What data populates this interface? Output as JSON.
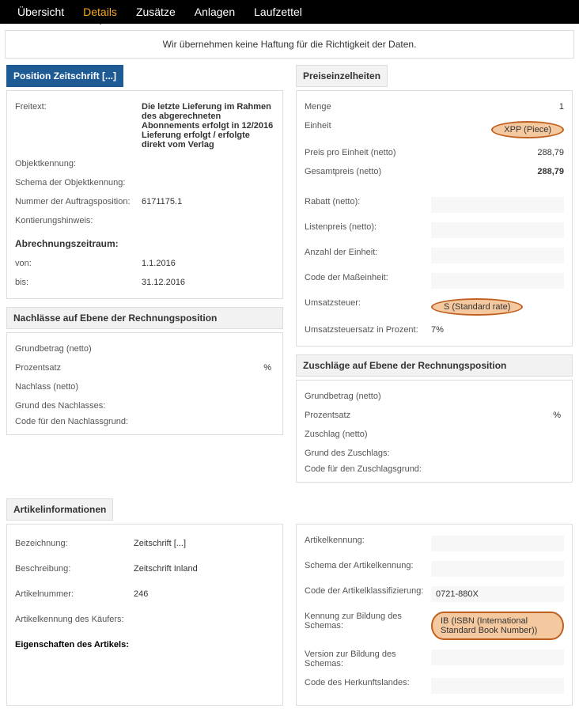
{
  "nav": {
    "uebersicht": "Übersicht",
    "details": "Details",
    "zusaetze": "Zusätze",
    "anlagen": "Anlagen",
    "laufzettel": "Laufzettel"
  },
  "disclaimer": "Wir übernehmen keine Haftung für die Richtigkeit der Daten.",
  "left": {
    "title": "Position Zeitschrift [...]",
    "freitext_label": "Freitext:",
    "freitext_value": "Die letzte Lieferung im Rahmen des abgerechneten Abonnements erfolgt in 12/2016 Lieferung erfolgt / erfolgte direkt vom Verlag",
    "objektkennung_label": "Objektkennung:",
    "schema_obj_label": "Schema der Objektkennung:",
    "nummer_label": "Nummer der Auftragsposition:",
    "nummer_value": "6171175.1",
    "kontierung_label": "Kontierungshinweis:",
    "abrechnung_header": "Abrechnungszeitraum:",
    "von_label": "von:",
    "von_value": "1.1.2016",
    "bis_label": "bis:",
    "bis_value": "31.12.2016"
  },
  "right": {
    "title": "Preiseinzelheiten",
    "menge_label": "Menge",
    "menge_value": "1",
    "einheit_label": "Einheit",
    "einheit_value": "XPP (Piece)",
    "ppe_label": "Preis pro Einheit (netto)",
    "ppe_value": "288,79",
    "gesamt_label": "Gesamtpreis (netto)",
    "gesamt_value": "288,79",
    "rabatt_label": "Rabatt (netto):",
    "listenpreis_label": "Listenpreis (netto):",
    "anzahl_label": "Anzahl der Einheit:",
    "code_mass_label": "Code der Maßeinheit:",
    "ust_label": "Umsatzsteuer:",
    "ust_value": "S (Standard rate)",
    "ust_prozent_label": "Umsatzsteuersatz in Prozent:",
    "ust_prozent_value": "7%"
  },
  "nachlass": {
    "title": "Nachlässe auf Ebene der Rechnungsposition",
    "grundbetrag": "Grundbetrag (netto)",
    "prozentsatz": "Prozentsatz",
    "pct": "%",
    "nachlass": "Nachlass (netto)",
    "grund1": "Grund des Nachlasses:",
    "grund2": "Code für den Nachlassgrund:"
  },
  "zuschlag": {
    "title": "Zuschläge auf Ebene der Rechnungsposition",
    "grundbetrag": "Grundbetrag (netto)",
    "prozentsatz": "Prozentsatz",
    "pct": "%",
    "zuschlag": "Zuschlag (netto)",
    "grund1": "Grund des Zuschlags:",
    "grund2": "Code für den Zuschlagsgrund:"
  },
  "artikel": {
    "title": "Artikelinformationen",
    "bez_label": "Bezeichnung:",
    "bez_value": "Zeitschrift [...]",
    "beschr_label": "Beschreibung:",
    "beschr_value": "Zeitschrift Inland",
    "artnr_label": "Artikelnummer:",
    "artnr_value": "246",
    "artkenn_label": "Artikelkennung des Käufers:",
    "eig_label": "Eigenschaften des Artikels:",
    "r_artkenn_label": "Artikelkennung:",
    "r_schema_label": "Schema der Artikelkennung:",
    "r_code_label": "Code der Artikelklassifizierung:",
    "r_code_value": "0721-880X",
    "r_kennung_label": "Kennung zur Bildung des Schemas:",
    "r_kennung_value": "IB (ISBN (International Standard Book Number))",
    "r_version_label": "Version zur Bildung des Schemas:",
    "r_herkunft_label": "Code des Herkunftslandes:"
  }
}
